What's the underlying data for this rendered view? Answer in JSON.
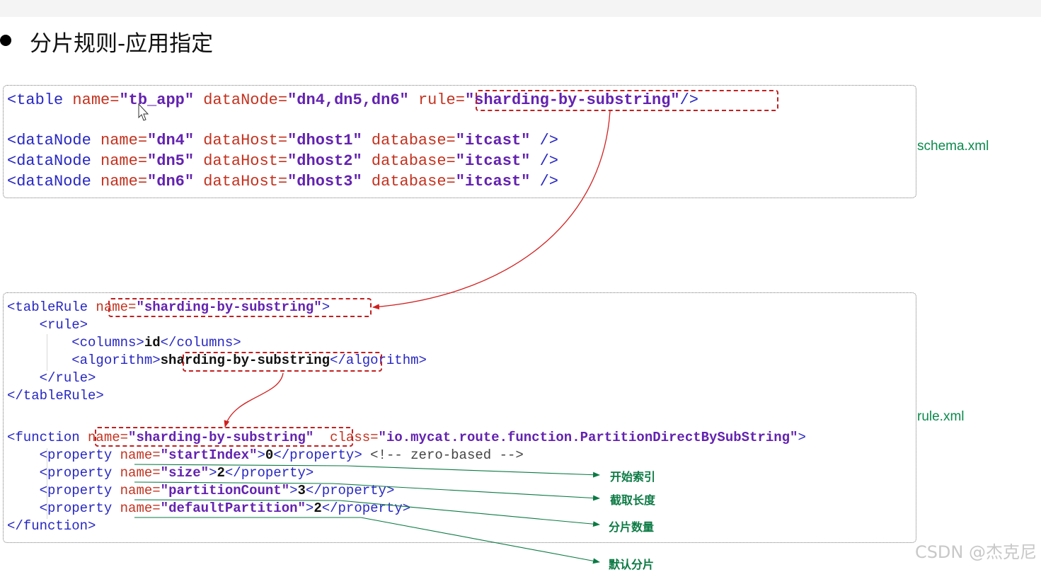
{
  "slide": {
    "title": "分片规则-应用指定"
  },
  "schema": {
    "file_label": "schema.xml",
    "table": {
      "name": "tb_app",
      "dataNode": "dn4,dn5,dn6",
      "rule": "sharding-by-substring"
    },
    "dataNodes": [
      {
        "name": "dn4",
        "dataHost": "dhost1",
        "database": "itcast"
      },
      {
        "name": "dn5",
        "dataHost": "dhost2",
        "database": "itcast"
      },
      {
        "name": "dn6",
        "dataHost": "dhost3",
        "database": "itcast"
      }
    ]
  },
  "rule": {
    "file_label": "rule.xml",
    "tableRule": {
      "name": "sharding-by-substring",
      "columns": "id",
      "algorithm": "sharding-by-substring"
    },
    "function": {
      "name": "sharding-by-substring",
      "class": "io.mycat.route.function.PartitionDirectBySubString",
      "properties": [
        {
          "name": "startIndex",
          "value": "0",
          "comment": "<!-- zero-based -->"
        },
        {
          "name": "size",
          "value": "2"
        },
        {
          "name": "partitionCount",
          "value": "3"
        },
        {
          "name": "defaultPartition",
          "value": "2"
        }
      ]
    }
  },
  "annotations": [
    "开始索引",
    "截取长度",
    "分片数量",
    "默认分片"
  ],
  "watermark": "CSDN @杰克尼",
  "colors": {
    "tag": "#2727c4",
    "attr": "#c4321f",
    "value": "#6322b0",
    "highlight": "#c21f1f",
    "note": "#0b7a44"
  }
}
